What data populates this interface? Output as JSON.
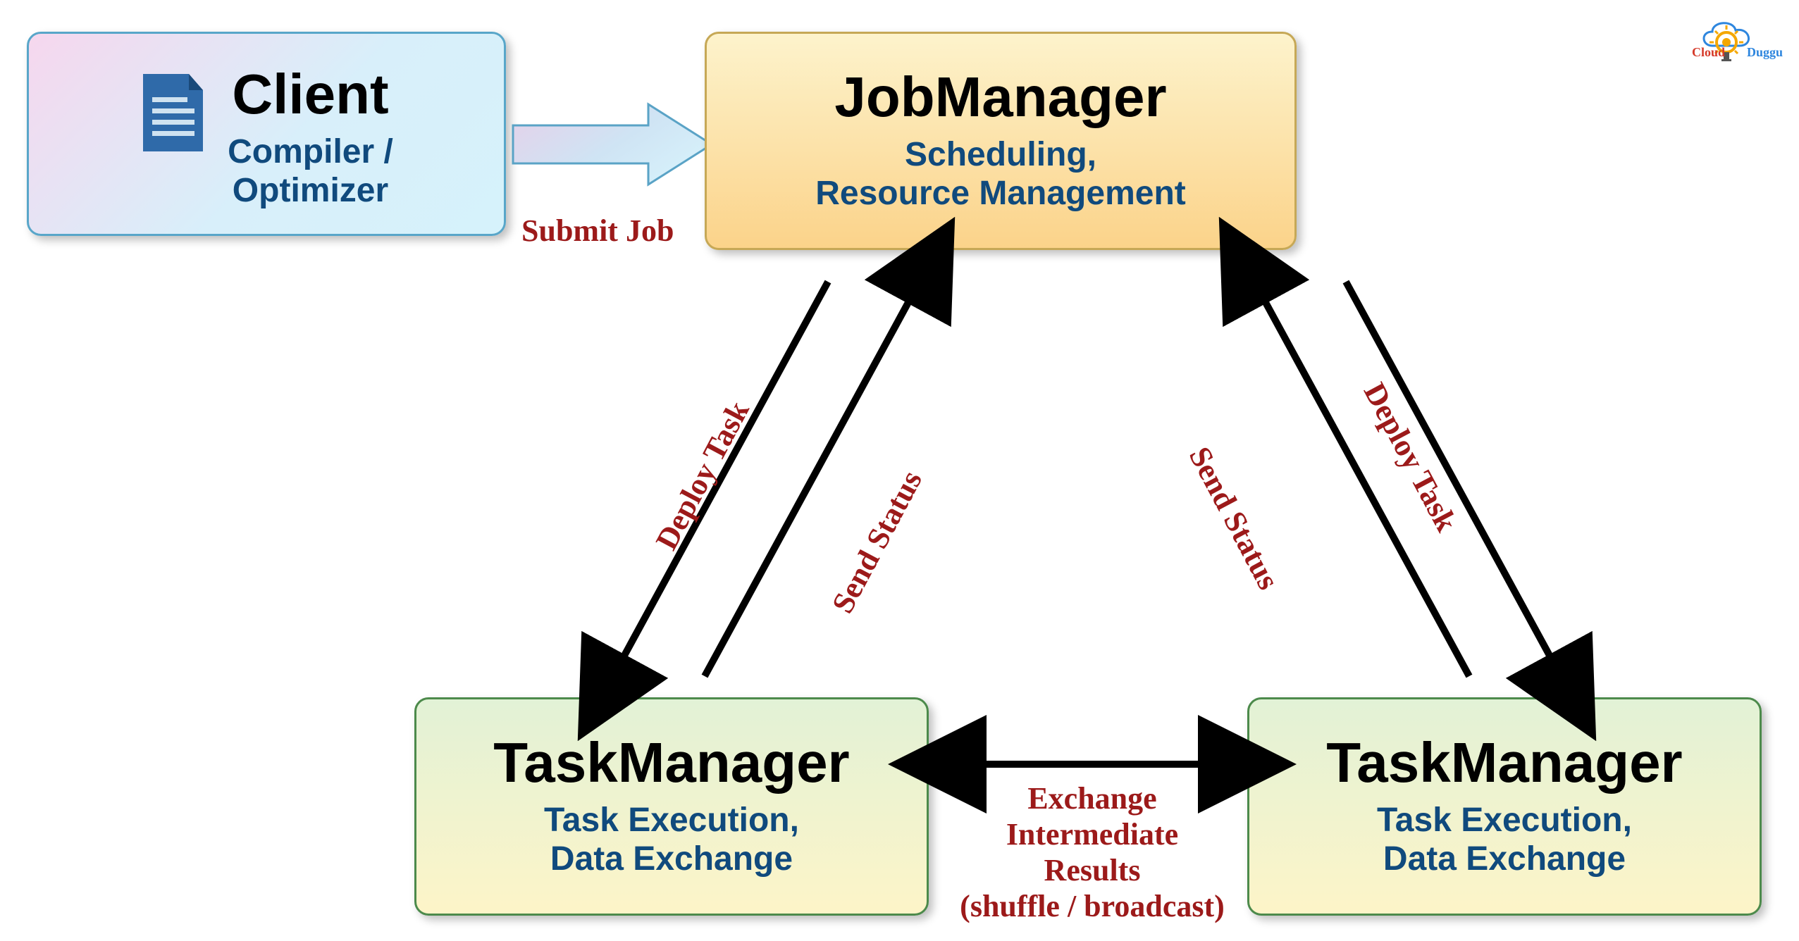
{
  "client": {
    "title": "Client",
    "subtitle": "Compiler /\nOptimizer"
  },
  "jobmanager": {
    "title": "JobManager",
    "subtitle": "Scheduling,\nResource Management"
  },
  "taskmanager1": {
    "title": "TaskManager",
    "subtitle": "Task Execution,\nData Exchange"
  },
  "taskmanager2": {
    "title": "TaskManager",
    "subtitle": "Task Execution,\nData Exchange"
  },
  "labels": {
    "submit": "Submit Job",
    "deploy_left": "Deploy Task",
    "status_left": "Send Status",
    "status_right": "Send Status",
    "deploy_right": "Deploy Task",
    "exchange_l1": "Exchange",
    "exchange_l2": "Intermediate",
    "exchange_l3": "Results",
    "exchange_l4": "(shuffle / broadcast)"
  },
  "logo": {
    "left": "Cloud",
    "right": "Duggu"
  },
  "colors": {
    "label_red": "#9c1a1a",
    "subtitle_blue": "#104a7d",
    "doc_blue": "#2f6aa9",
    "client_border": "#58a6c9",
    "jm_border": "#c6a856",
    "tm_border": "#4c8a4b"
  }
}
